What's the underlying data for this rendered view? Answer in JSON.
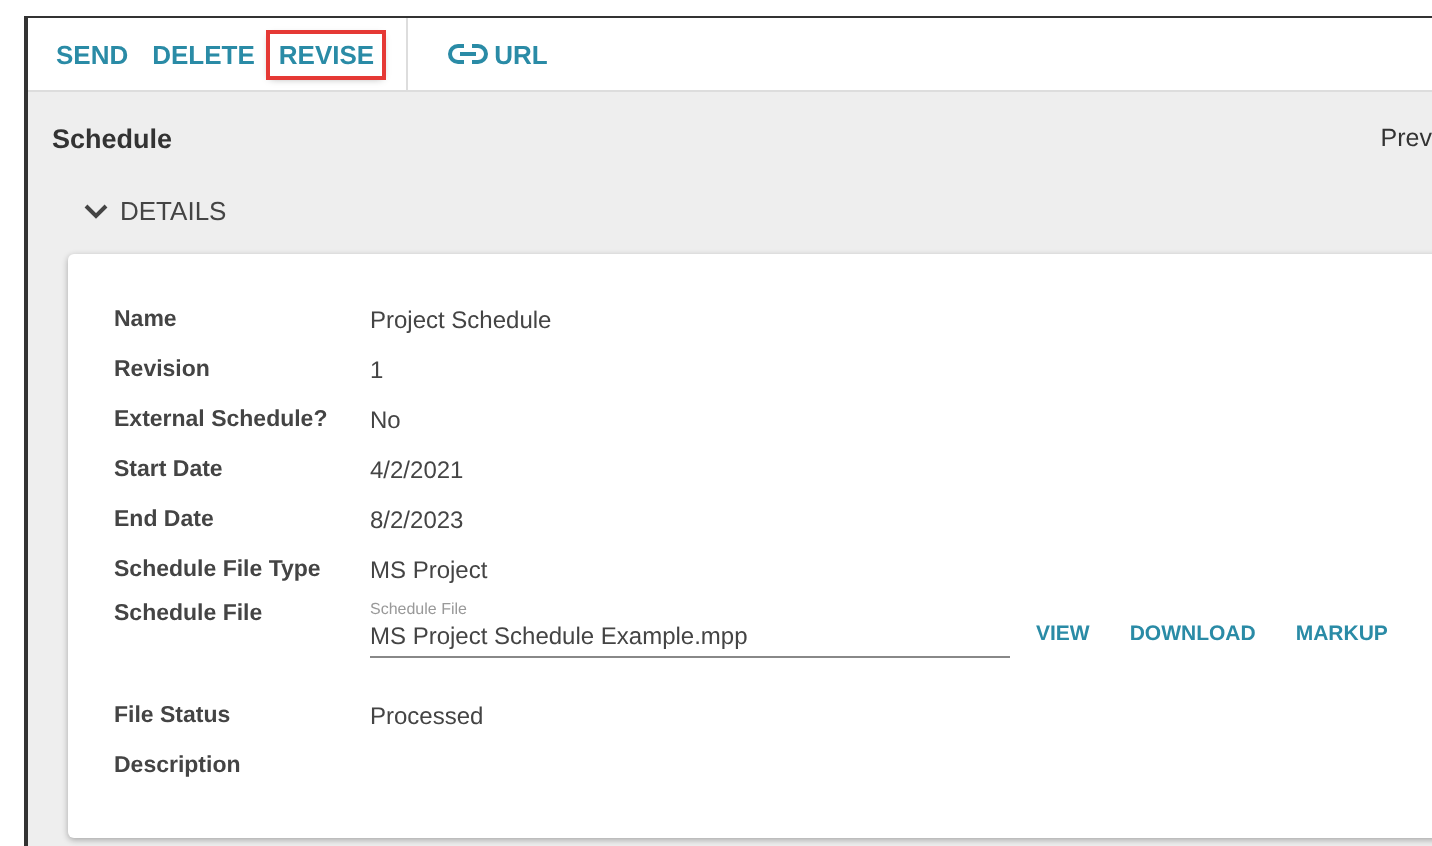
{
  "toolbar": [
    {
      "label": "SEND",
      "kind": "button",
      "highlighted": false
    },
    {
      "label": "DELETE",
      "kind": "button",
      "highlighted": false
    },
    {
      "label": "REVISE",
      "kind": "button",
      "highlighted": true
    },
    {
      "label": "URL",
      "kind": "link",
      "highlighted": false
    }
  ],
  "header": {
    "title": "Schedule",
    "right_text": "Prev"
  },
  "section": {
    "label": "DETAILS",
    "expanded": true
  },
  "fields": [
    {
      "kind": "text",
      "label": "Name",
      "value": "Project Schedule"
    },
    {
      "kind": "text",
      "label": "Revision",
      "value": "1"
    },
    {
      "kind": "text",
      "label": "External Schedule?",
      "value": "No"
    },
    {
      "kind": "text",
      "label": "Start Date",
      "value": "4/2/2021"
    },
    {
      "kind": "text",
      "label": "End Date",
      "value": "8/2/2023"
    },
    {
      "kind": "text",
      "label": "Schedule File Type",
      "value": "MS Project"
    },
    {
      "kind": "file",
      "label": "Schedule File",
      "field_label": "Schedule File",
      "value": "MS Project Schedule Example.mpp",
      "actions": [
        "VIEW",
        "DOWNLOAD",
        "MARKUP"
      ]
    },
    {
      "kind": "text",
      "label": "File Status",
      "value": "Processed"
    },
    {
      "kind": "text",
      "label": "Description"
    }
  ]
}
